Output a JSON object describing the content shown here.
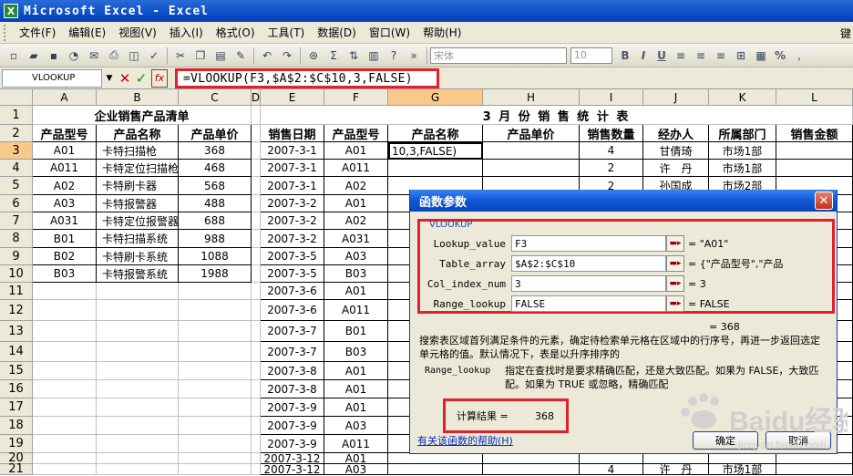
{
  "window": {
    "title": "Microsoft Excel - Excel",
    "app_icon": "X"
  },
  "menu": {
    "items": [
      "文件(F)",
      "编辑(E)",
      "视图(V)",
      "插入(I)",
      "格式(O)",
      "工具(T)",
      "数据(D)",
      "窗口(W)",
      "帮助(H)"
    ],
    "right_text": "键"
  },
  "toolbar": {
    "font": "宋体",
    "size": "10",
    "bold": "B",
    "italic": "I",
    "underline": "U",
    "percent": "%"
  },
  "formula_bar": {
    "name_box": "VLOOKUP",
    "formula": "=VLOOKUP(F3,$A$2:$C$10,3,FALSE)",
    "cancel": "✕",
    "enter": "✓",
    "fx": "fx"
  },
  "columns": [
    "A",
    "B",
    "C",
    "D",
    "E",
    "F",
    "G",
    "H",
    "I",
    "J",
    "K",
    "L"
  ],
  "rows": [
    "1",
    "2",
    "3",
    "4",
    "5",
    "6",
    "7",
    "8",
    "9",
    "10",
    "11",
    "12",
    "13",
    "14",
    "15",
    "16",
    "17",
    "18",
    "19",
    "20",
    "21"
  ],
  "left_table": {
    "title": "企业销售产品清单",
    "headers": [
      "产品型号",
      "产品名称",
      "产品单价"
    ],
    "rows": [
      [
        "A01",
        "卡特扫描枪",
        "368"
      ],
      [
        "A011",
        "卡特定位扫描枪",
        "468"
      ],
      [
        "A02",
        "卡特刷卡器",
        "568"
      ],
      [
        "A03",
        "卡特报警器",
        "488"
      ],
      [
        "A031",
        "卡特定位报警器",
        "688"
      ],
      [
        "B01",
        "卡特扫描系统",
        "988"
      ],
      [
        "B02",
        "卡特刷卡系统",
        "1088"
      ],
      [
        "B03",
        "卡特报警系统",
        "1988"
      ]
    ]
  },
  "right_table": {
    "title": "3 月 份 销 售 统 计 表",
    "headers": [
      "销售日期",
      "产品型号",
      "产品名称",
      "产品单价",
      "销售数量",
      "经办人",
      "所属部门",
      "销售金额"
    ],
    "active_cell_text": "10,3,FALSE)",
    "rows": [
      [
        "2007-3-1",
        "A01",
        "",
        "",
        "4",
        "甘倩琦",
        "市场1部",
        ""
      ],
      [
        "2007-3-1",
        "A011",
        "",
        "",
        "2",
        "许　丹",
        "市场1部",
        ""
      ],
      [
        "2007-3-1",
        "A02",
        "",
        "",
        "",
        "",
        "",
        ""
      ],
      [
        "2007-3-2",
        "A01",
        "",
        "",
        "",
        "",
        "",
        ""
      ],
      [
        "2007-3-2",
        "A02",
        "",
        "",
        "",
        "",
        "",
        ""
      ],
      [
        "2007-3-2",
        "A031",
        "",
        "",
        "",
        "",
        "",
        ""
      ],
      [
        "2007-3-5",
        "A03",
        "",
        "",
        "",
        "",
        "",
        ""
      ],
      [
        "2007-3-5",
        "B03",
        "",
        "",
        "",
        "",
        "",
        ""
      ],
      [
        "2007-3-6",
        "A01",
        "",
        "",
        "",
        "",
        "",
        ""
      ],
      [
        "2007-3-6",
        "A011",
        "",
        "",
        "",
        "",
        "",
        ""
      ],
      [
        "2007-3-7",
        "B01",
        "",
        "",
        "",
        "",
        "",
        ""
      ],
      [
        "2007-3-7",
        "B03",
        "",
        "",
        "",
        "",
        "",
        ""
      ],
      [
        "2007-3-8",
        "A01",
        "",
        "",
        "",
        "",
        "",
        ""
      ],
      [
        "2007-3-8",
        "A01",
        "",
        "",
        "",
        "",
        "",
        ""
      ],
      [
        "2007-3-9",
        "A01",
        "",
        "",
        "",
        "",
        "",
        ""
      ],
      [
        "2007-3-9",
        "A03",
        "",
        "",
        "",
        "",
        "",
        ""
      ],
      [
        "2007-3-9",
        "A011",
        "",
        "",
        "",
        "",
        "",
        ""
      ],
      [
        "2007-3-12",
        "A01",
        "",
        "",
        "",
        "",
        "",
        ""
      ],
      [
        "2007-3-12",
        "A03",
        "",
        "",
        "4",
        "许　丹",
        "市场1部",
        ""
      ]
    ],
    "partial_row5": [
      "2",
      "孙国成",
      "市场2部"
    ]
  },
  "dialog": {
    "title": "函数参数",
    "function_name": "VLOOKUP",
    "args": [
      {
        "label": "Lookup_value",
        "input": "F3",
        "value": "= \"A01\""
      },
      {
        "label": "Table_array",
        "input": "$A$2:$C$10",
        "value": "= {\"产品型号\",\"产品"
      },
      {
        "label": "Col_index_num",
        "input": "3",
        "value": "= 3"
      },
      {
        "label": "Range_lookup",
        "input": "FALSE",
        "value": "= FALSE"
      }
    ],
    "result_preview": "= 368",
    "description": "搜索表区域首列满足条件的元素，确定待检索单元格在区域中的行序号，再进一步返回选定单元格的值。默认情况下，表是以升序排序的",
    "arg_help_name": "Range_lookup",
    "arg_help_text": "指定在查找时是要求精确匹配，还是大致匹配。如果为 FALSE，大致匹配。如果为 TRUE 或忽略，精确匹配",
    "result_label": "计算结果 =",
    "result_value": "368",
    "help_link": "有关该函数的帮助(H)",
    "ok": "确定",
    "cancel": "取消"
  },
  "watermark": {
    "text": "Baidu经验",
    "sub": "jingyan.baidu.com"
  }
}
